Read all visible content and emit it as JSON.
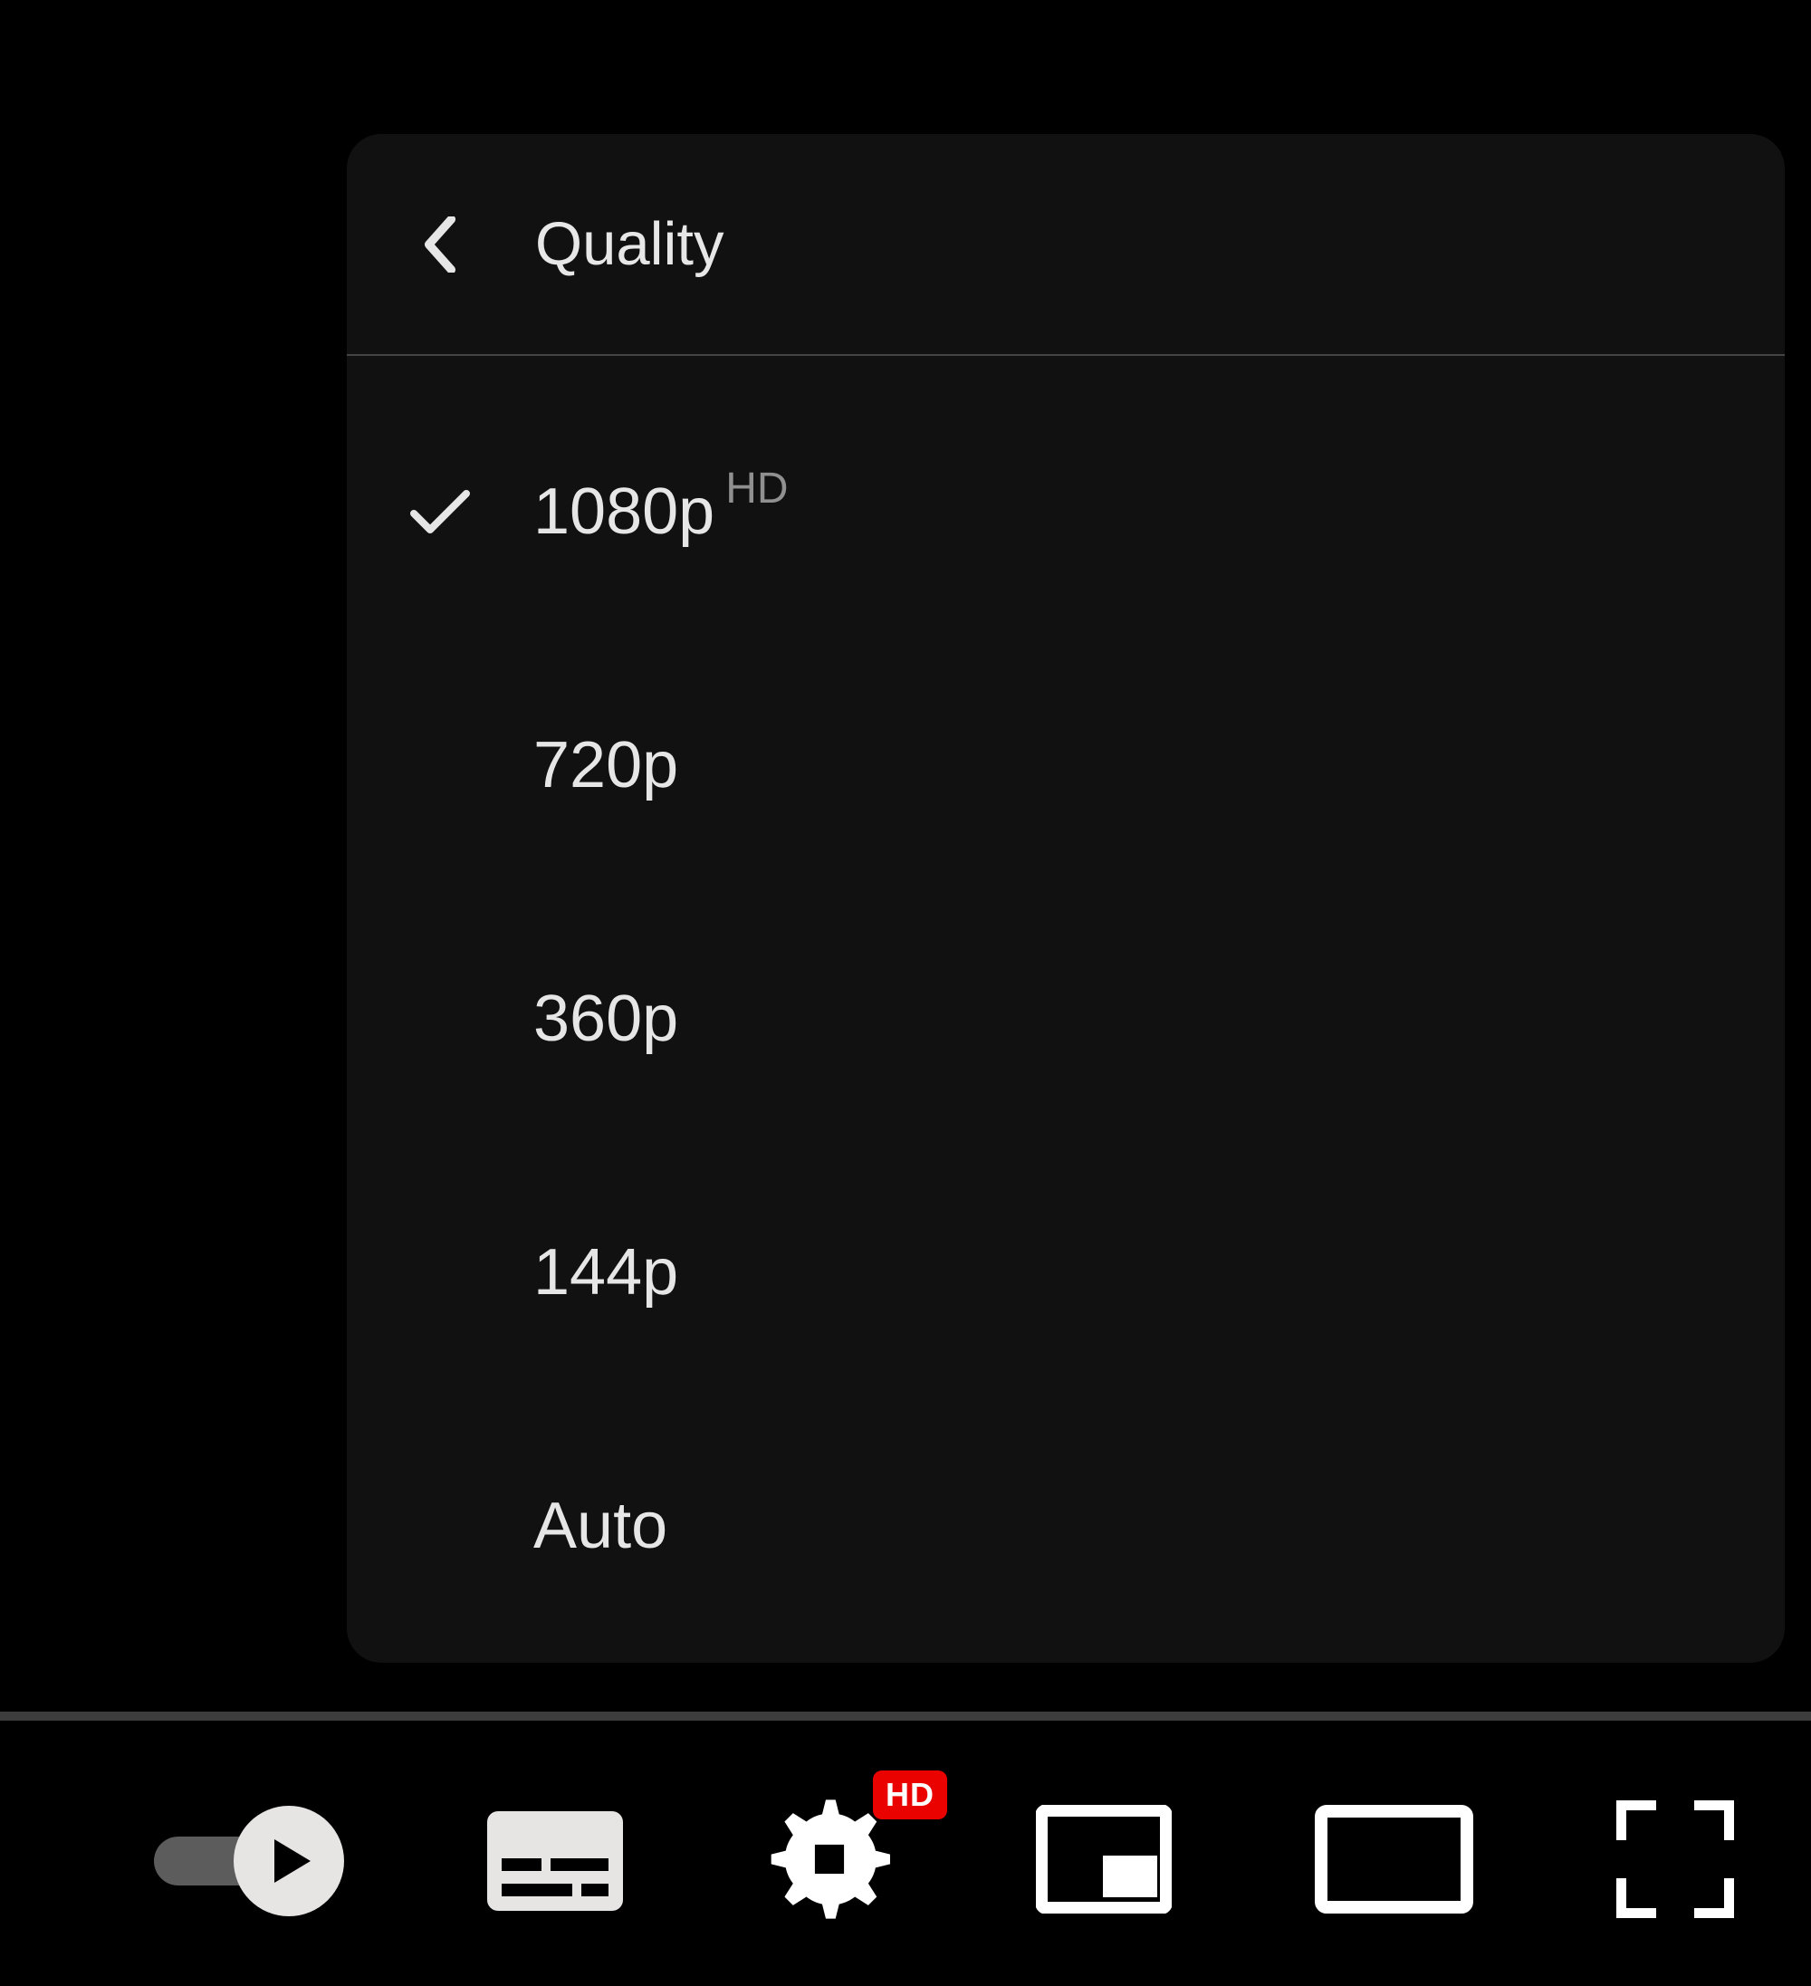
{
  "menu": {
    "title": "Quality",
    "options": [
      {
        "label": "1080p",
        "sup": "HD",
        "selected": true
      },
      {
        "label": "720p",
        "sup": "",
        "selected": false
      },
      {
        "label": "360p",
        "sup": "",
        "selected": false
      },
      {
        "label": "144p",
        "sup": "",
        "selected": false
      },
      {
        "label": "Auto",
        "sup": "",
        "selected": false
      }
    ]
  },
  "controls": {
    "autoplay_on": true,
    "settings_badge": "HD"
  },
  "colors": {
    "background": "#000000",
    "panel": "#111111",
    "text": "#e6e6e6",
    "muted": "#909090",
    "badge_bg": "#ea0200",
    "track": "#3d3d3d",
    "toggle_track": "#5c5c5c",
    "icon_fill": "#e7e4e4"
  }
}
